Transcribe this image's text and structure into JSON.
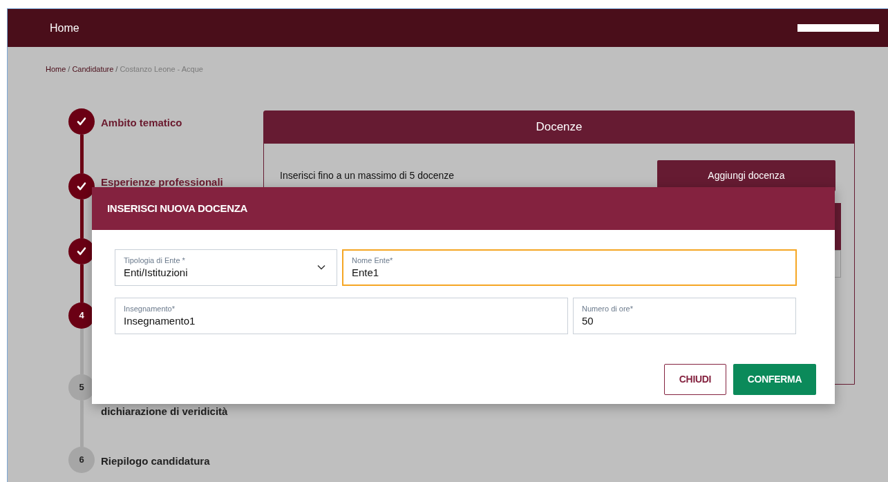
{
  "header": {
    "title": "Home",
    "user_redacted": true
  },
  "breadcrumb": {
    "separator": "/",
    "items": [
      {
        "label": "Home",
        "current": false
      },
      {
        "label": "Candidature",
        "current": false
      },
      {
        "label": "Costanzo Leone - Acque",
        "current": true
      }
    ]
  },
  "steps": [
    {
      "done": true,
      "current": false,
      "label": "Ambito tematico"
    },
    {
      "done": true,
      "current": false,
      "label": "Esperienze professionali"
    },
    {
      "done": true,
      "current": false
    },
    {
      "number": "4",
      "done": false,
      "current": true
    },
    {
      "number": "5",
      "done": false,
      "current": false,
      "label": "dichiarazione di veridicità"
    },
    {
      "number": "6",
      "done": false,
      "current": false,
      "label": "Riepilogo candidatura"
    }
  ],
  "card": {
    "title": "Docenze",
    "text": "Inserisci fino a un massimo di 5 docenze",
    "button": "Aggiungi docenza"
  },
  "modal": {
    "title": "INSERISCI NUOVA DOCENZA",
    "fields": [
      {
        "kind": "select",
        "label": "Tipologia di Ente *",
        "value": "Enti/Istituzioni",
        "focused": false
      },
      {
        "kind": "text",
        "label": "Nome Ente*",
        "value": "Ente1",
        "focused": true
      },
      {
        "kind": "text",
        "label": "Insegnamento*",
        "value": "Insegnamento1",
        "focused": false
      },
      {
        "kind": "text",
        "label": "Numero di ore*",
        "value": "50",
        "focused": false
      }
    ],
    "buttons": [
      {
        "kind": "secondary",
        "label": "CHIUDI"
      },
      {
        "kind": "primary",
        "label": "CONFERMA"
      }
    ]
  }
}
